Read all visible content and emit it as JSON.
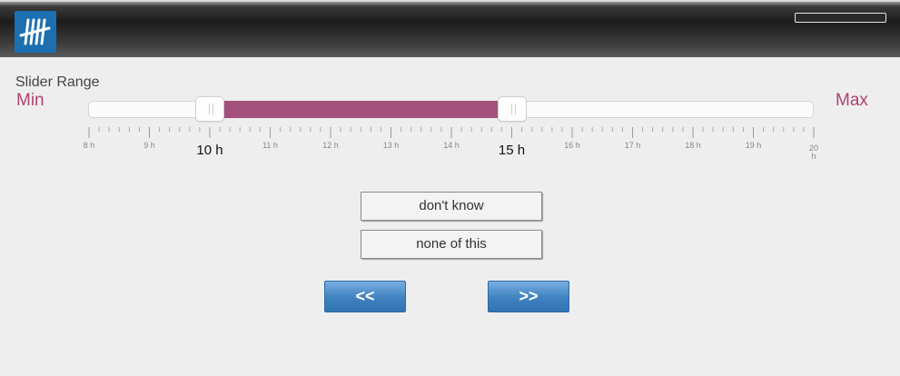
{
  "header": {
    "logo_icon": "tally-marks-icon",
    "progress_percent": 0
  },
  "question": {
    "title": "Slider Range",
    "min_label": "Min",
    "max_label": "Max"
  },
  "slider": {
    "min": 8,
    "max": 20,
    "step_minor_per_hour": 6,
    "tick_labels": [
      "8 h",
      "9 h",
      "10 h",
      "11 h",
      "12 h",
      "13 h",
      "14 h",
      "15 h",
      "16 h",
      "17 h",
      "18 h",
      "19 h",
      "20 h"
    ],
    "selected_low": 10,
    "selected_high": 15,
    "selected_low_label": "10 h",
    "selected_high_label": "15 h",
    "fill_color": "#a3517a"
  },
  "options": {
    "dont_know": "don't know",
    "none_of_this": "none of this"
  },
  "navigation": {
    "back_label": "<<",
    "next_label": ">>"
  }
}
